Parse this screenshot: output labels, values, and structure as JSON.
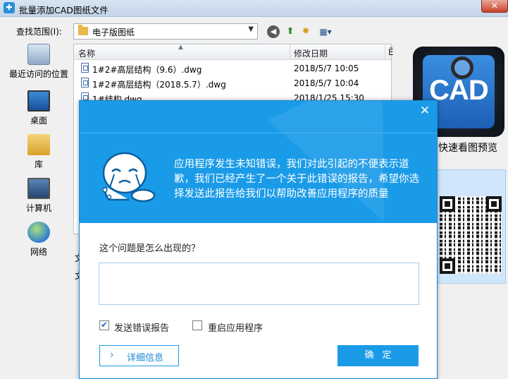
{
  "window": {
    "title": "批量添加CAD图纸文件",
    "close_glyph": "✕"
  },
  "toolbar": {
    "lookin_label": "查找范围(I):",
    "lookin_value": "电子版图纸"
  },
  "places": [
    {
      "label": "最近访问的位置",
      "icon": "recent-places-icon"
    },
    {
      "label": "桌面",
      "icon": "desktop-icon"
    },
    {
      "label": "库",
      "icon": "library-icon"
    },
    {
      "label": "计算机",
      "icon": "computer-icon"
    },
    {
      "label": "网络",
      "icon": "network-icon"
    }
  ],
  "filelist": {
    "columns": [
      "名称",
      "修改日期",
      "Ë"
    ],
    "files": [
      {
        "name": "1#2#高层结构（9.6）.dwg",
        "date": "2018/5/7 10:05"
      },
      {
        "name": "1#2#高层结构（2018.5.7）.dwg",
        "date": "2018/5/7 10:04"
      },
      {
        "name": "1#结构.dwg",
        "date": "2018/1/25 15:30"
      }
    ]
  },
  "obscured_labels": [
    "文",
    "文"
  ],
  "preview": {
    "logo_text": "CAD",
    "caption": "快速看图预览"
  },
  "error_dialog": {
    "close_glyph": "✕",
    "message": "应用程序发生未知错误，我们对此引起的不便表示道歉，我们已经产生了一个关于此错误的报告，希望你选择发送此报告给我们以帮助改善应用程序的质量",
    "question": "这个问题是怎么出现的？",
    "question_value": "",
    "send_report_label": "发送错误报告",
    "send_report_checked": true,
    "restart_label": "重启应用程序",
    "restart_checked": false,
    "details_label": "详细信息",
    "ok_label": "确定"
  },
  "colors": {
    "dialog_blue": "#1a9be8",
    "titlebar": "#d7e4f2"
  }
}
